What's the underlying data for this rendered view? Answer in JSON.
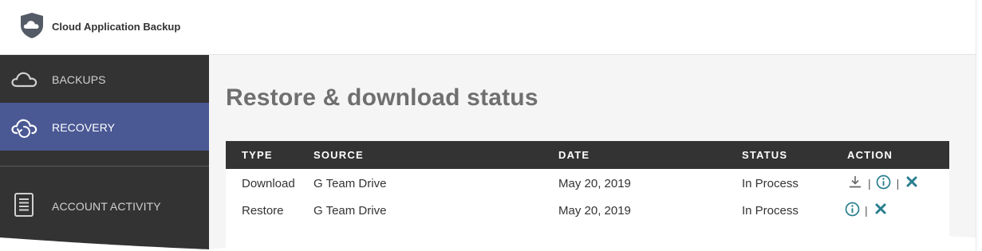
{
  "header": {
    "app_title": "Cloud Application Backup"
  },
  "sidebar": {
    "items": [
      {
        "label": "BACKUPS",
        "icon": "cloud-icon",
        "active": false
      },
      {
        "label": "RECOVERY",
        "icon": "cloud-restore-icon",
        "active": true
      },
      {
        "label": "ACCOUNT ACTIVITY",
        "icon": "document-list-icon",
        "active": false
      }
    ]
  },
  "main": {
    "title": "Restore & download status",
    "table": {
      "columns": [
        "TYPE",
        "SOURCE",
        "DATE",
        "STATUS",
        "ACTION"
      ],
      "rows": [
        {
          "type": "Download",
          "source": "G Team Drive",
          "date": "May 20, 2019",
          "status": "In Process",
          "actions": [
            "download-icon",
            "info-icon",
            "close-icon"
          ]
        },
        {
          "type": "Restore",
          "source": "G Team Drive",
          "date": "May 20, 2019",
          "status": "In Process",
          "actions": [
            "info-icon",
            "close-icon"
          ]
        }
      ],
      "separator": "|"
    }
  },
  "colors": {
    "sidebar_bg": "#333333",
    "active_item": "#4a5894",
    "table_header": "#333333",
    "action_icon": "#2a7f8f",
    "title_text": "#6f6f6f"
  }
}
